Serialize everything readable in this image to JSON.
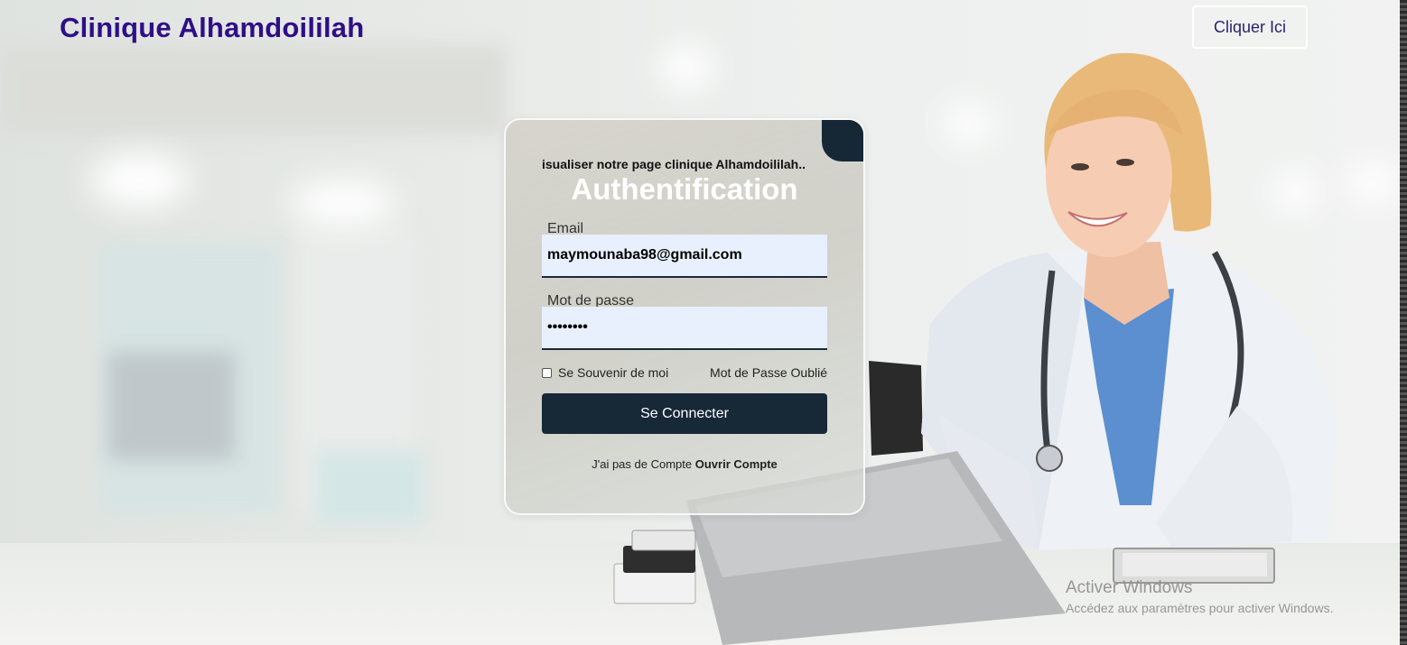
{
  "header": {
    "brand": "Clinique Alhamdoililah",
    "cta_label": "Cliquer Ici"
  },
  "login": {
    "marquee": "isualiser notre page clinique Alhamdoililah..",
    "title": "Authentification",
    "email_label": "Email",
    "email_value": "maymounaba98@gmail.com",
    "password_label": "Mot de passe",
    "password_value": "••••••••",
    "remember_label": "Se Souvenir de moi",
    "remember_checked": false,
    "forgot_label": "Mot de Passe Oublié",
    "submit_label": "Se Connecter",
    "signup_prefix": "J'ai pas de Compte",
    "signup_link": "Ouvrir Compte"
  },
  "windows_watermark": {
    "line1": "Activer Windows",
    "line2": "Accédez aux paramètres pour activer Windows."
  },
  "colors": {
    "brand": "#2f0f86",
    "button": "#172837",
    "input_bg": "#e8f0fe"
  }
}
